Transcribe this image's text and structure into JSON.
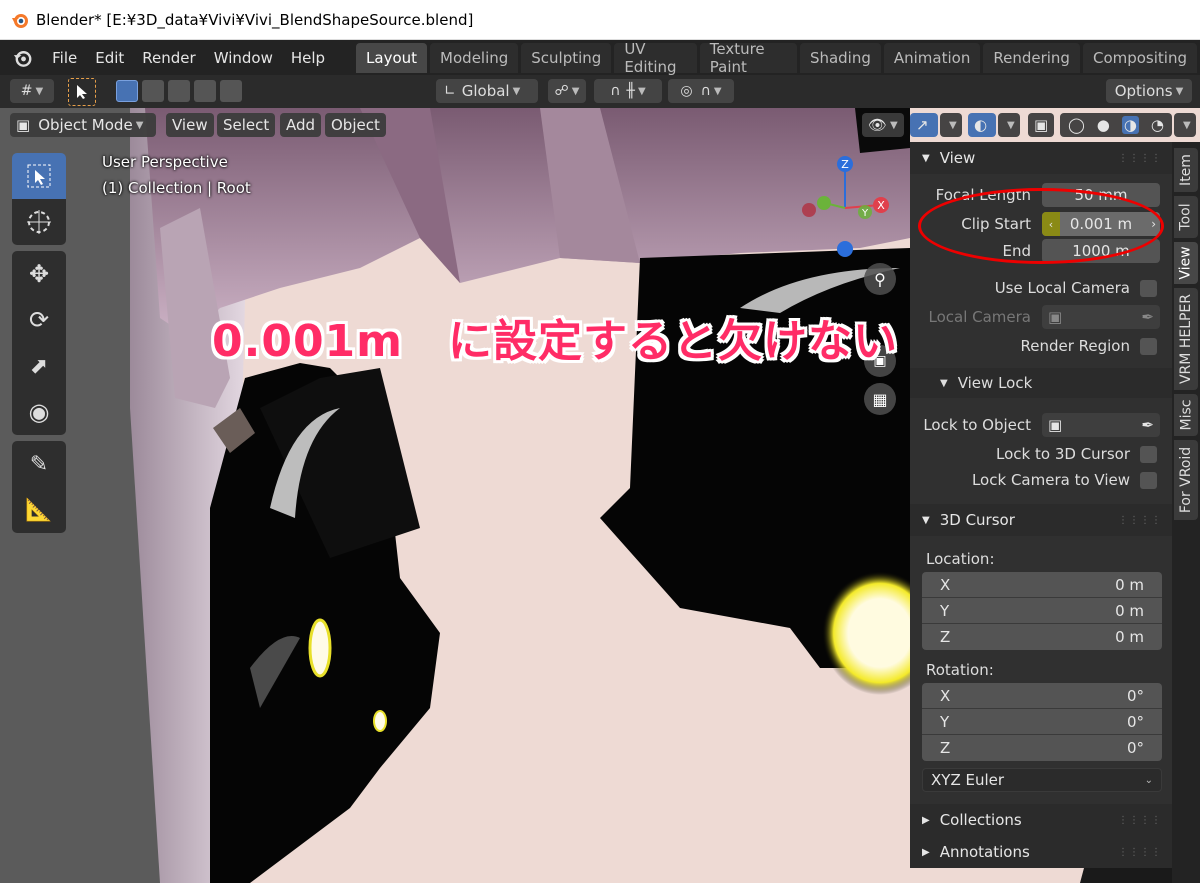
{
  "window": {
    "title": "Blender* [E:¥3D_data¥Vivi¥Vivi_BlendShapeSource.blend]"
  },
  "menu": [
    "File",
    "Edit",
    "Render",
    "Window",
    "Help"
  ],
  "workspaces": [
    "Layout",
    "Modeling",
    "Sculpting",
    "UV Editing",
    "Texture Paint",
    "Shading",
    "Animation",
    "Rendering",
    "Compositing"
  ],
  "active_workspace": "Layout",
  "toolheader": {
    "orientation": "Global",
    "options_label": "Options"
  },
  "viewport_header": {
    "mode": "Object Mode",
    "menus": [
      "View",
      "Select",
      "Add",
      "Object"
    ]
  },
  "viewport_overlay": {
    "line1": "User Perspective",
    "line2": "(1) Collection | Root"
  },
  "annotation": "0.001m　に設定すると欠けない",
  "gizmo": {
    "z": "Z",
    "y": "Y",
    "x": "X"
  },
  "npanel": {
    "view": {
      "title": "View",
      "focal_length_label": "Focal Length",
      "focal_length": "50 mm",
      "clip_start_label": "Clip Start",
      "clip_start": "0.001 m",
      "clip_end_label": "End",
      "clip_end": "1000 m",
      "use_local_camera": "Use Local Camera",
      "local_camera": "Local Camera",
      "render_region": "Render Region"
    },
    "view_lock": {
      "title": "View Lock",
      "lock_to_object": "Lock to Object",
      "lock_to_3d_cursor": "Lock to 3D Cursor",
      "lock_camera_to_view": "Lock Camera to View"
    },
    "cursor": {
      "title": "3D Cursor",
      "location_label": "Location:",
      "location": [
        {
          "axis": "X",
          "value": "0 m"
        },
        {
          "axis": "Y",
          "value": "0 m"
        },
        {
          "axis": "Z",
          "value": "0 m"
        }
      ],
      "rotation_label": "Rotation:",
      "rotation": [
        {
          "axis": "X",
          "value": "0°"
        },
        {
          "axis": "Y",
          "value": "0°"
        },
        {
          "axis": "Z",
          "value": "0°"
        }
      ],
      "rotation_mode": "XYZ Euler"
    },
    "collections": "Collections",
    "annotations": "Annotations"
  },
  "sidetabs": [
    "Item",
    "Tool",
    "View",
    "VRM HELPER",
    "Misc",
    "For VRoid"
  ],
  "colors": {
    "accent": "#4772b3",
    "annotation": "#ff2c66",
    "ellipse": "#e00000"
  }
}
